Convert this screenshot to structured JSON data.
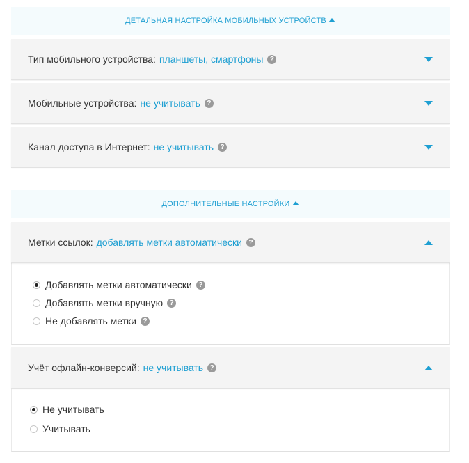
{
  "mobile_section": {
    "header": "Детальная настройка мобильных устройств",
    "rows": [
      {
        "label": "Тип мобильного устройства:",
        "value": "планшеты, смартфоны"
      },
      {
        "label": "Мобильные устройства:",
        "value": "не учитывать"
      },
      {
        "label": "Канал доступа в Интернет:",
        "value": "не учитывать"
      }
    ]
  },
  "extra_section": {
    "header": "Дополнительные настройки",
    "link_tags": {
      "label": "Метки ссылок:",
      "value": "добавлять метки автоматически",
      "options": [
        {
          "label": "Добавлять метки автоматически",
          "checked": true
        },
        {
          "label": "Добавлять метки вручную",
          "checked": false
        },
        {
          "label": "Не добавлять метки",
          "checked": false
        }
      ]
    },
    "offline_conversions": {
      "label": "Учёт офлайн-конверсий:",
      "value": "не учитывать",
      "options": [
        {
          "label": "Не учитывать",
          "checked": true
        },
        {
          "label": "Учитывать",
          "checked": false
        }
      ]
    }
  },
  "help_glyph": "?",
  "colors": {
    "accent": "#1e9fd2",
    "row_bg": "#f4f4f4",
    "section_bg": "#f4fbfd"
  }
}
